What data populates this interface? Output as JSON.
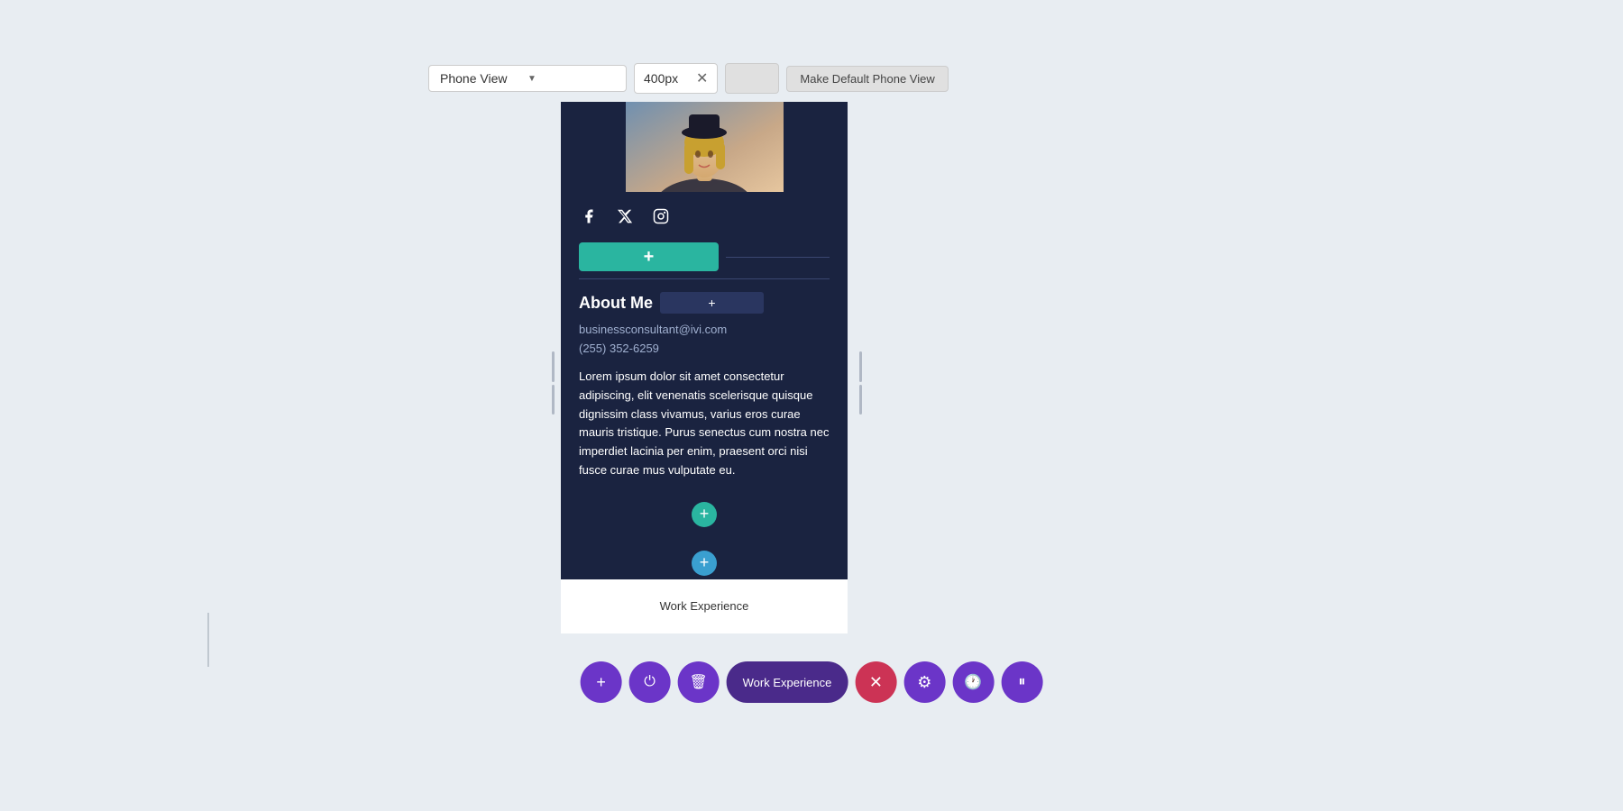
{
  "toolbar": {
    "view_select_label": "Phone View",
    "width_value": "400px",
    "make_default_label": "Make Default Phone View"
  },
  "mobile": {
    "social": {
      "facebook_icon": "f",
      "twitter_icon": "𝕏",
      "instagram_icon": "◻"
    },
    "add_btn_label": "+",
    "about_title": "About Me",
    "email": "businessconsultant@ivi.com",
    "phone": "(255) 352-6259",
    "bio": "Lorem ipsum dolor sit amet consectetur adipiscing, elit venenatis scelerisque quisque dignissim class vivamus, varius eros curae mauris tristique. Purus senectus cum nostra nec imperdiet lacinia per enim, praesent orci nisi fusce curae mus vulputate eu.",
    "work_exp_label": "Work Experience"
  },
  "bottom_toolbar": {
    "add_label": "+",
    "power_label": "⏻",
    "trash_label": "🗑",
    "section_label": "Work Experience",
    "close_label": "✕",
    "gear_label": "⚙",
    "clock_label": "🕐",
    "pause_label": "⏸"
  }
}
